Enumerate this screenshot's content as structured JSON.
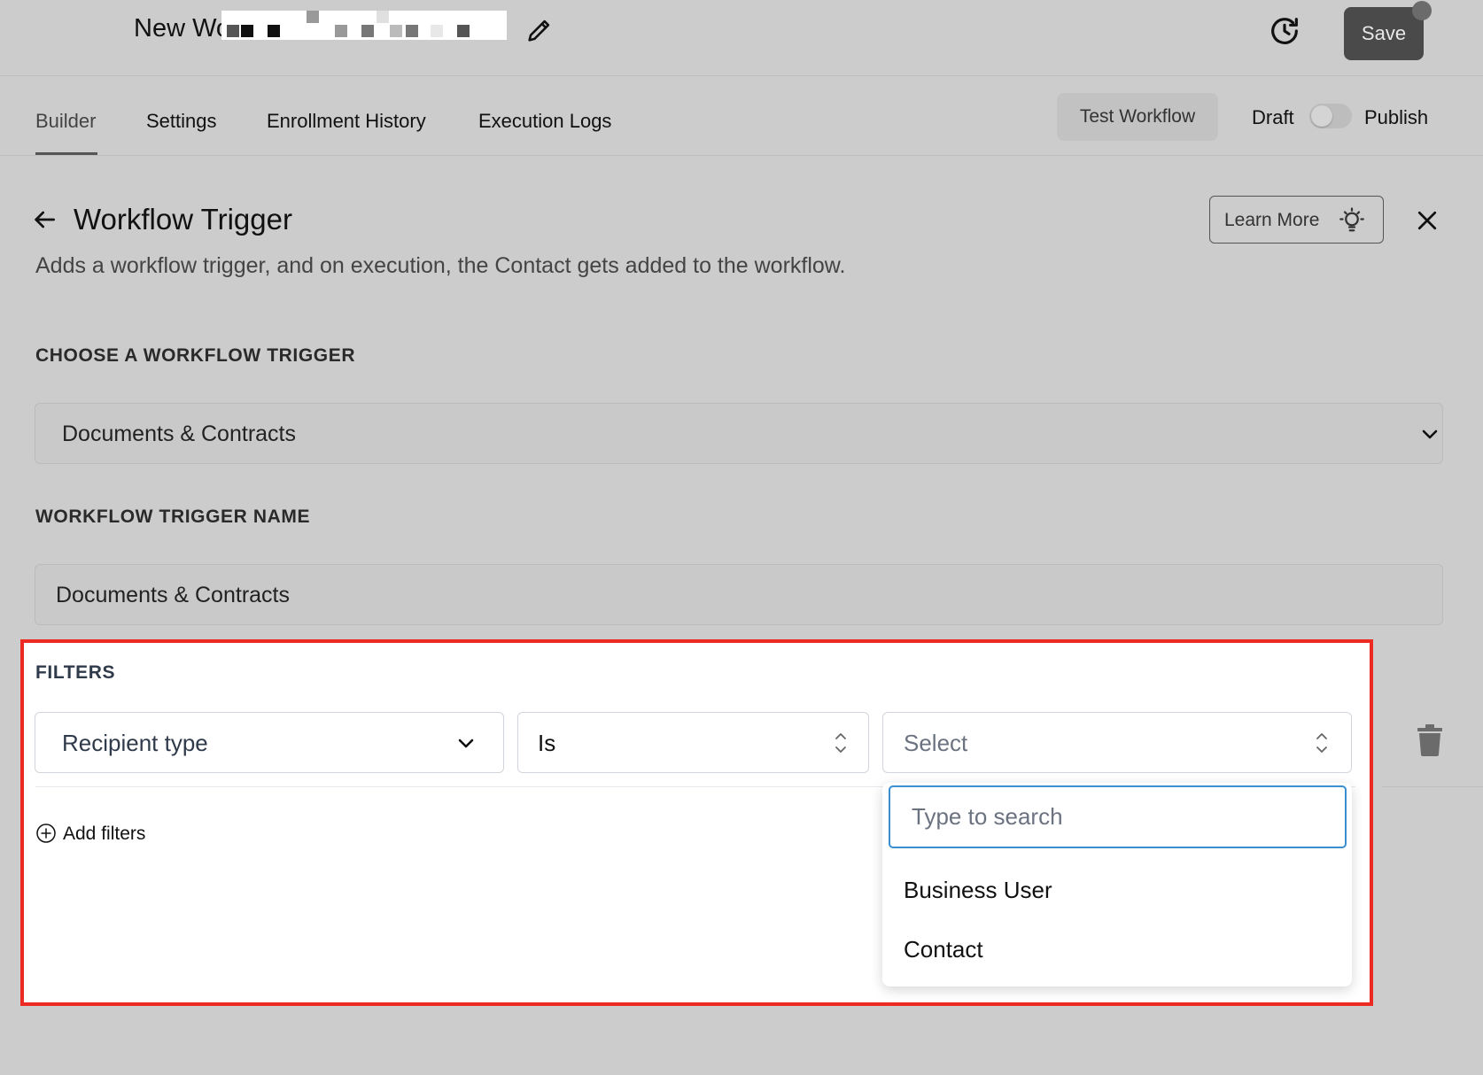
{
  "header": {
    "workflow_title": "New Wo",
    "save_label": "Save"
  },
  "tabs": [
    {
      "label": "Builder",
      "active": true
    },
    {
      "label": "Settings",
      "active": false
    },
    {
      "label": "Enrollment History",
      "active": false
    },
    {
      "label": "Execution Logs",
      "active": false
    }
  ],
  "actions": {
    "test_label": "Test Workflow",
    "draft_label": "Draft",
    "publish_label": "Publish",
    "publish_enabled": false
  },
  "panel": {
    "title": "Workflow Trigger",
    "description": "Adds a workflow trigger, and on execution, the Contact gets added to the workflow.",
    "learn_more_label": "Learn More"
  },
  "trigger": {
    "section_label": "CHOOSE A WORKFLOW TRIGGER",
    "selected": "Documents & Contracts"
  },
  "trigger_name": {
    "section_label": "WORKFLOW TRIGGER NAME",
    "value": "Documents & Contracts"
  },
  "filters": {
    "section_label": "FILTERS",
    "field": "Recipient type",
    "operator": "Is",
    "value_placeholder": "Select",
    "search_placeholder": "Type to search",
    "options": [
      "Business User",
      "Contact"
    ],
    "add_label": "Add filters"
  },
  "colors": {
    "highlight_border": "#ec2a22",
    "focus_border": "#3b8fd1",
    "overlay_bg": "#cccccc"
  },
  "icons": [
    "pencil-icon",
    "history-icon",
    "back-arrow-icon",
    "lightbulb-icon",
    "close-icon",
    "chevron-down-icon",
    "updown-icon",
    "plus-circle-icon",
    "trash-icon"
  ]
}
